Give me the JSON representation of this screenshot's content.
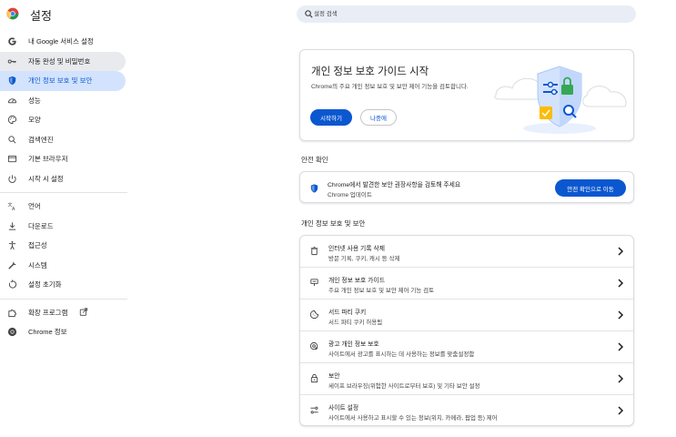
{
  "app": {
    "title": "설정"
  },
  "search": {
    "placeholder": "설정 검색"
  },
  "sidebar": {
    "items": [
      {
        "label": "내 Google 서비스 설정",
        "icon": "google-g-icon"
      },
      {
        "label": "자동 완성 및 비밀번호",
        "icon": "key-icon"
      },
      {
        "label": "개인 정보 보호 및 보안",
        "icon": "shield-icon"
      },
      {
        "label": "성능",
        "icon": "speedometer-icon"
      },
      {
        "label": "모양",
        "icon": "palette-icon"
      },
      {
        "label": "검색엔진",
        "icon": "search-icon"
      },
      {
        "label": "기본 브라우저",
        "icon": "browser-window-icon"
      },
      {
        "label": "시작 시 설정",
        "icon": "power-icon"
      }
    ],
    "items2": [
      {
        "label": "언어",
        "icon": "translate-icon"
      },
      {
        "label": "다운로드",
        "icon": "download-icon"
      },
      {
        "label": "접근성",
        "icon": "accessibility-icon"
      },
      {
        "label": "시스템",
        "icon": "wrench-icon"
      },
      {
        "label": "설정 초기화",
        "icon": "reset-icon"
      }
    ],
    "items3": [
      {
        "label": "확장 프로그램",
        "icon": "puzzle-icon"
      },
      {
        "label": "Chrome 정보",
        "icon": "chrome-icon"
      }
    ],
    "active_index": 2,
    "hover_index": 1
  },
  "guide": {
    "title": "개인 정보 보호 가이드 시작",
    "description": "Chrome의 주요 개인 정보 보호 및 보안 제어 기능을 검토합니다.",
    "start_label": "시작하기",
    "later_label": "나중에"
  },
  "safety": {
    "section_title": "안전 확인",
    "title": "Chrome에서 발견한 보안 권장사항을 검토해 주세요",
    "subtitle": "Chrome 업데이트",
    "button_label": "안전 확인으로 이동"
  },
  "privacy": {
    "section_title": "개인 정보 보호 및 보안",
    "rows": [
      {
        "title": "인터넷 사용 기록 삭제",
        "subtitle": "방문 기록, 쿠키, 캐시 등 삭제",
        "icon": "trash-icon"
      },
      {
        "title": "개인 정보 보호 가이드",
        "subtitle": "주요 개인 정보 보호 및 보안 제어 기능 검토",
        "icon": "guide-icon"
      },
      {
        "title": "서드 파티 쿠키",
        "subtitle": "서드 파티 쿠키 허용됨",
        "icon": "cookie-icon"
      },
      {
        "title": "광고 개인 정보 보호",
        "subtitle": "사이트에서 광고를 표시하는 데 사용하는 정보를 맞춤설정함",
        "icon": "ad-privacy-icon"
      },
      {
        "title": "보안",
        "subtitle": "세이프 브라우징(위험한 사이트로부터 보호) 및 기타 보안 설정",
        "icon": "lock-icon"
      },
      {
        "title": "사이트 설정",
        "subtitle": "사이트에서 사용하고 표시할 수 있는 정보(위치, 카메라, 팝업 등) 제어",
        "icon": "site-settings-icon"
      }
    ]
  },
  "colors": {
    "accent": "#0b57d0",
    "active_bg": "#d3e3fd",
    "search_bg": "#e9eef6",
    "hover_bg": "#e8eaed"
  }
}
